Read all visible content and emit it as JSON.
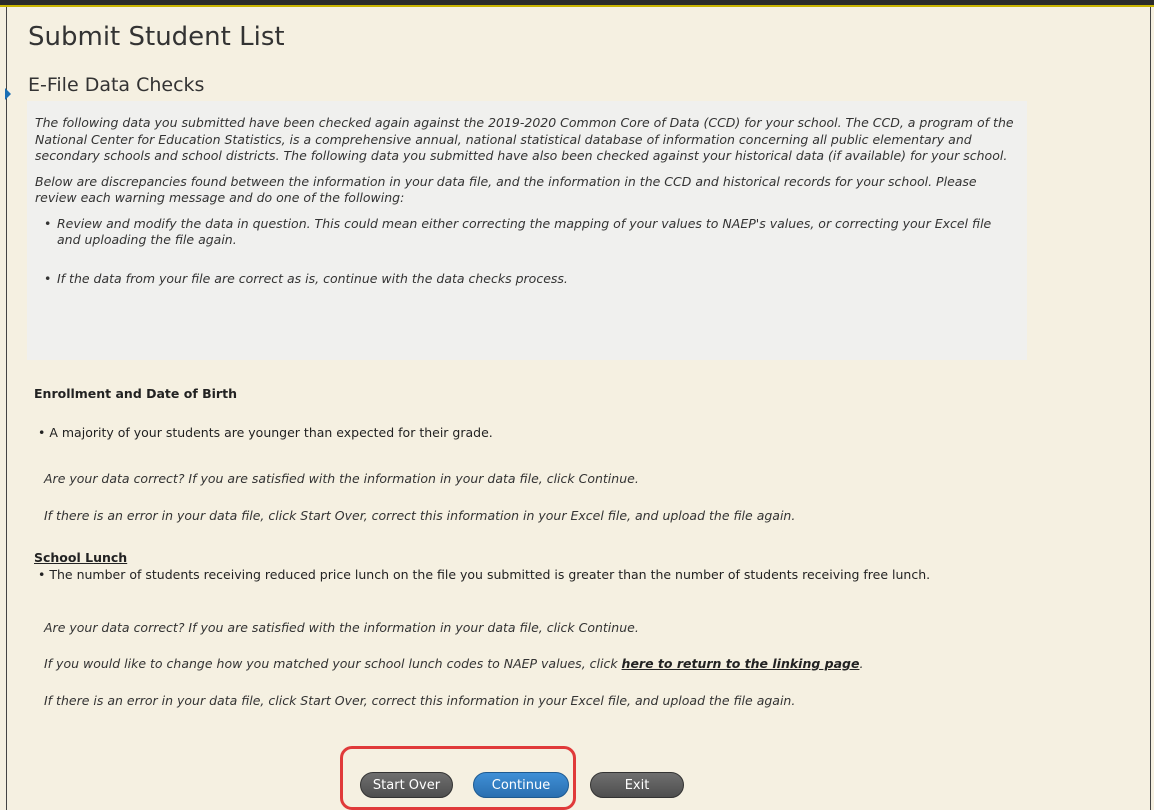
{
  "page": {
    "title": "Submit Student List",
    "section": "E-File Data Checks"
  },
  "info": {
    "p1": "The following data you submitted have been checked again against the 2019-2020 Common Core of Data (CCD) for your school. The CCD, a program of the National Center for Education Statistics, is a comprehensive annual, national statistical database of information concerning all public elementary and secondary schools and school districts. The following data you submitted have also been checked against your historical data (if available) for your school.",
    "p2": "Below are discrepancies found between the information in your data file, and the information in the CCD and historical records for your school. Please review each warning message and do one of the following:",
    "bullet1": "Review and modify the data in question. This could mean either correcting the mapping of your values to NAEP's values, or correcting your Excel file and uploading the file again.",
    "bullet2": "If the data from your file are correct as is, continue with the data checks process."
  },
  "enrollment": {
    "heading": "Enrollment and Date of Birth",
    "bullet": "A majority of your students are younger than expected for their grade.",
    "line1": "Are your data correct? If you are satisfied with the information in your data file, click Continue.",
    "line2": "If there is an error in your data file, click Start Over, correct this information in your Excel file, and upload the file again."
  },
  "lunch": {
    "heading": "School Lunch",
    "bullet": "The number of students receiving reduced price lunch on the file you submitted is greater than the number of students receiving free lunch.",
    "line1": "Are your data correct? If you are satisfied with the information in your data file, click Continue.",
    "line2_prefix": "If you would like to change how you matched your school lunch codes to NAEP values, click ",
    "line2_link": "here to return to the linking page",
    "line2_suffix": ".",
    "line3": "If there is an error in your data file, click Start Over, correct this information in your Excel file, and upload the file again."
  },
  "buttons": {
    "start_over": "Start Over",
    "continue": "Continue",
    "exit": "Exit"
  },
  "colors": {
    "background": "#f5f0e1",
    "highlight": "#e03a3a",
    "continue_blue": "#2a6fb0"
  }
}
